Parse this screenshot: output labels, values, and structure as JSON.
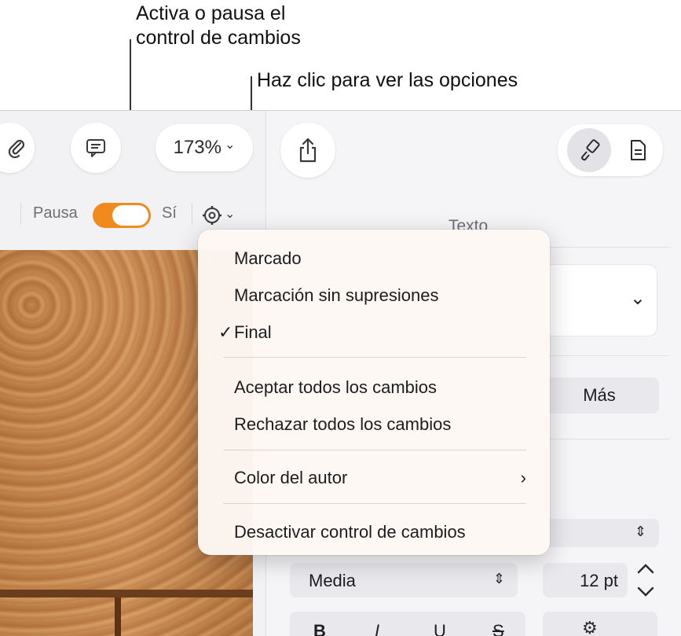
{
  "callouts": {
    "toggle_line1": "Activa o pausa el",
    "toggle_line2": "control de cambios",
    "options": "Haz clic para ver las opciones"
  },
  "toolbar": {
    "zoom": "173%",
    "zoom_chevron": "⌄",
    "attach_icon": "paperclip-icon",
    "comment_icon": "comment-icon",
    "share_icon": "share-icon",
    "format_icon": "paintbrush-icon",
    "document_icon": "document-icon"
  },
  "track_changes": {
    "pause_label": "Pausa",
    "on_label": "Sí",
    "toggle_on": true,
    "accent": "#f08a1c"
  },
  "menu": {
    "items": [
      {
        "label": "Marcado"
      },
      {
        "label": "Marcación sin supresiones"
      },
      {
        "label": "Final",
        "checked": true
      },
      {
        "label": "Aceptar todos los cambios"
      },
      {
        "label": "Rechazar todos los cambios"
      },
      {
        "label": "Color del autor",
        "submenu": true
      },
      {
        "label": "Desactivar control de cambios"
      }
    ],
    "check_mark": "✓",
    "submenu_chevron": "›"
  },
  "inspector": {
    "tab_label": "Texto",
    "more_button": "Más",
    "font_weight": "Media",
    "font_size": "12 pt",
    "bold": "B",
    "italic": "I",
    "underline": "U",
    "strike": "S"
  }
}
